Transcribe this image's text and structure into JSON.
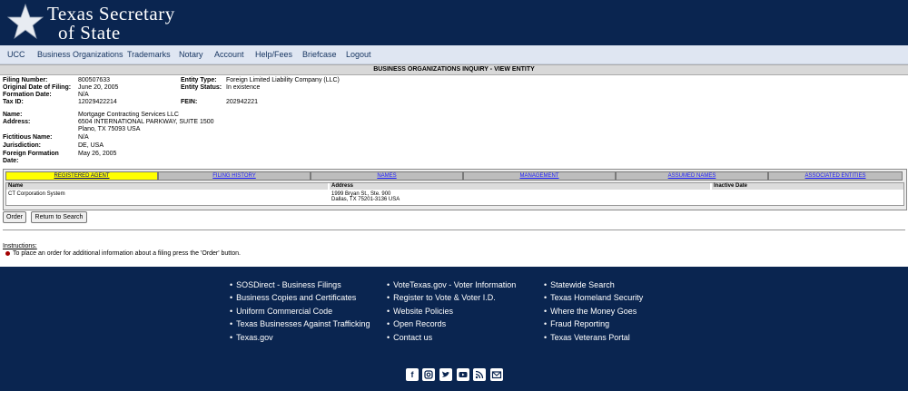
{
  "header": {
    "logo_line1": "Texas Secretary",
    "logo_line2": "of State"
  },
  "nav": [
    "UCC",
    "Business Organizations",
    "Trademarks",
    "Notary",
    "Account",
    "Help/Fees",
    "Briefcase",
    "Logout"
  ],
  "page_title": "BUSINESS ORGANIZATIONS INQUIRY - VIEW ENTITY",
  "entity": {
    "filing_number_label": "Filing Number:",
    "filing_number": "800507633",
    "orig_date_label": "Original Date of Filing:",
    "orig_date": "June 20, 2005",
    "formation_date_label": "Formation Date:",
    "formation_date": "N/A",
    "tax_id_label": "Tax ID:",
    "tax_id": "12029422214",
    "entity_type_label": "Entity Type:",
    "entity_type": "Foreign Limited Liability Company (LLC)",
    "entity_status_label": "Entity Status:",
    "entity_status": "In existence",
    "fein_label": "FEIN:",
    "fein": "202942221",
    "name_label": "Name:",
    "name": "Mortgage Contracting Services LLC",
    "address_label": "Address:",
    "address_line1": "6504 INTERNATIONAL PARKWAY, SUITE 1500",
    "address_line2": "Plano, TX 75093 USA",
    "fictitious_name_label": "Fictitious Name:",
    "fictitious_name": "N/A",
    "jurisdiction_label": "Jurisdiction:",
    "jurisdiction": "DE, USA",
    "foreign_formation_label1": "Foreign Formation",
    "foreign_formation_label2": "Date:",
    "foreign_formation": "May 26, 2005"
  },
  "tabs": [
    "REGISTERED AGENT",
    "FILING HISTORY",
    "NAMES",
    "MANAGEMENT",
    "ASSUMED NAMES",
    "ASSOCIATED ENTITIES"
  ],
  "agent_table": {
    "headers": [
      "Name",
      "Address",
      "Inactive Date"
    ],
    "row": {
      "name": "CT Corporation System",
      "address_line1": "1999 Bryan St., Ste. 900",
      "address_line2": "Dallas, TX 75201-3136 USA",
      "inactive": ""
    }
  },
  "buttons": {
    "order": "Order",
    "return": "Return to Search"
  },
  "instructions": {
    "title": "Instructions",
    "colon": ":",
    "text": "To place an order for additional information about a filing press the 'Order' button."
  },
  "footer": {
    "col1": [
      "SOSDirect - Business Filings",
      "Business Copies and Certificates",
      "Uniform Commercial Code",
      "Texas Businesses Against Trafficking",
      "Texas.gov"
    ],
    "col2": [
      "VoteTexas.gov - Voter Information",
      "Register to Vote & Voter I.D.",
      "Website Policies",
      "Open Records",
      "Contact us"
    ],
    "col3": [
      "Statewide Search",
      "Texas Homeland Security",
      "Where the Money Goes",
      "Fraud Reporting",
      "Texas Veterans Portal"
    ],
    "bullet": "•",
    "social_icons": [
      "facebook-icon",
      "instagram-icon",
      "twitter-icon",
      "youtube-icon",
      "rss-icon",
      "email-icon"
    ]
  }
}
